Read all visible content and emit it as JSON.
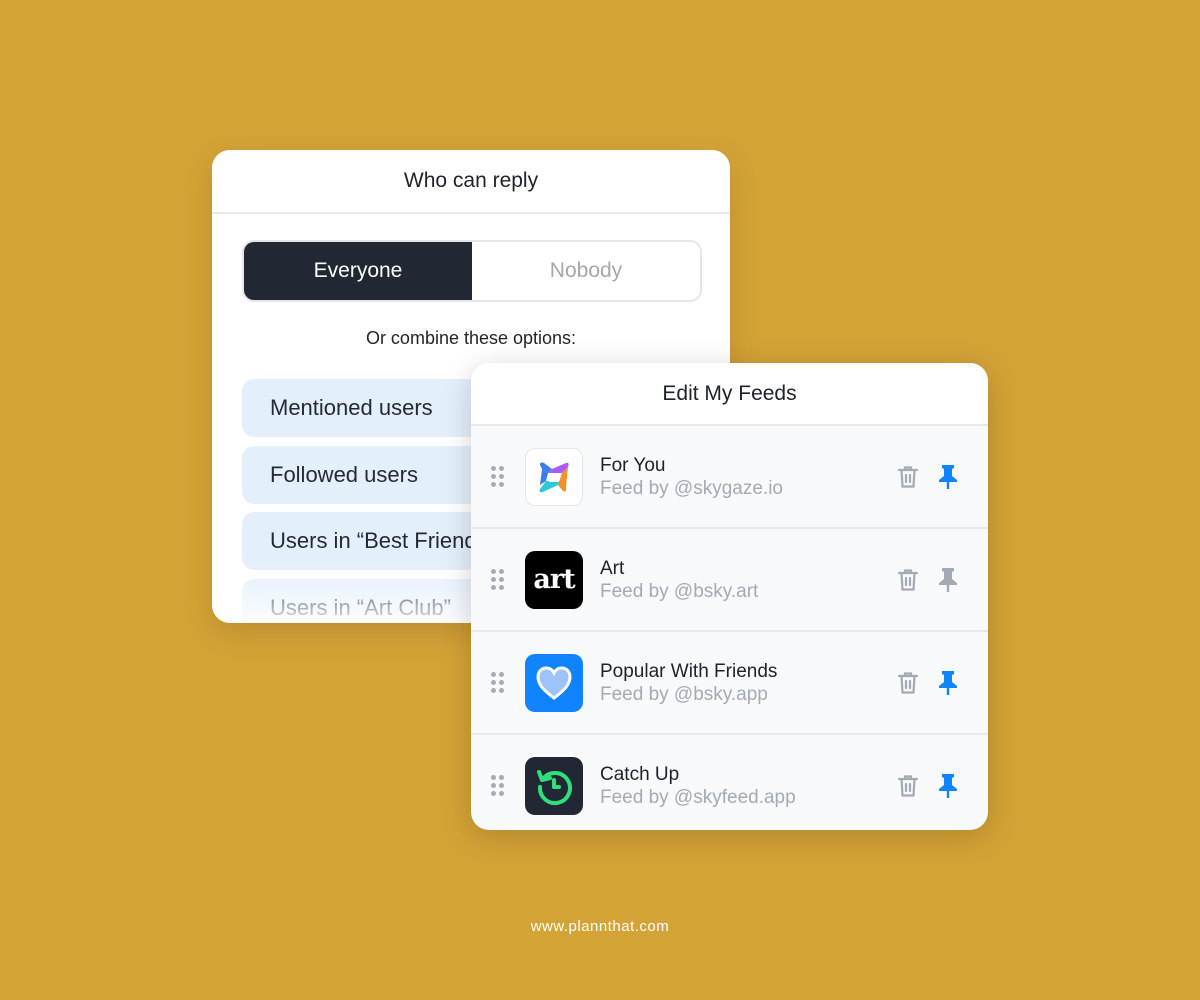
{
  "reply_dialog": {
    "title": "Who can reply",
    "segments": [
      {
        "label": "Everyone",
        "selected": true
      },
      {
        "label": "Nobody",
        "selected": false
      }
    ],
    "combine_label": "Or combine these options:",
    "options": [
      {
        "label": "Mentioned users"
      },
      {
        "label": "Followed users"
      },
      {
        "label": "Users in “Best Friends”"
      },
      {
        "label": "Users in “Art Club”"
      }
    ]
  },
  "feeds_dialog": {
    "title": "Edit My Feeds",
    "feeds": [
      {
        "name": "For You",
        "by": "Feed by @skygaze.io",
        "icon": "for-you-logo",
        "pinned": true
      },
      {
        "name": "Art",
        "by": "Feed by @bsky.art",
        "icon": "art-logo",
        "icon_text": "art",
        "pinned": false
      },
      {
        "name": "Popular With Friends",
        "by": "Feed by @bsky.app",
        "icon": "heart-icon",
        "pinned": true
      },
      {
        "name": "Catch Up",
        "by": "Feed by @skyfeed.app",
        "icon": "clock-history-icon",
        "pinned": true
      }
    ]
  },
  "colors": {
    "background": "#D4A336",
    "pin_active": "#1083FE",
    "pin_inactive": "#A4AAB3",
    "segment_selected": "#222833",
    "option_bg": "#E4EFFC"
  },
  "footer": {
    "text": "www.plannthat.com"
  }
}
